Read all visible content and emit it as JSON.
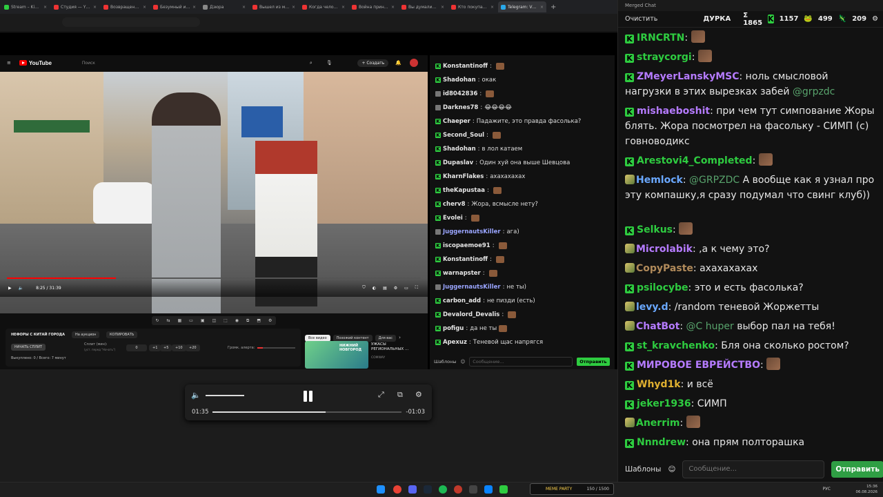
{
  "browser": {
    "tabs": [
      {
        "label": "Stream – Ki…",
        "color": "#2ecc40"
      },
      {
        "label": "Студия — Y…",
        "color": "#e33"
      },
      {
        "label": "Возвращен…",
        "color": "#e33"
      },
      {
        "label": "Безумный и…",
        "color": "#e33"
      },
      {
        "label": "Дзюра",
        "color": "#888"
      },
      {
        "label": "Вышел из м…",
        "color": "#e33"
      },
      {
        "label": "Когда чело…",
        "color": "#e33"
      },
      {
        "label": "Война прин…",
        "color": "#e33"
      },
      {
        "label": "Вы думали…",
        "color": "#e33"
      },
      {
        "label": "Кто покупа…",
        "color": "#e33"
      },
      {
        "label": "Telegram: V…",
        "color": "#29a9eb"
      }
    ]
  },
  "youtube": {
    "logo": "YouTube",
    "search_placeholder": "Поиск",
    "create": "+ Создать",
    "time": "8:25 / 31:39",
    "panel": {
      "title": "НЕФОРЫ С КИТАЙ ГОРОДА",
      "chip1": "На аукцион",
      "chip2": "КОПИРОВАТЬ",
      "start": "НАЧАТЬ СПЛИТ",
      "split_label": "Сплит (мин):",
      "split_sub": "(уст. перед \"Начать\")",
      "split_value": "0",
      "b1": "+1",
      "b2": "+5",
      "b3": "+10",
      "b4": "+20",
      "volume": "Громк. алерта:",
      "done": "Выкуплено: 0 / Всего: 7 минут"
    },
    "rel": {
      "chip_all": "Все видео",
      "chip_similar": "Похожий контент",
      "chip_you": "Для вас",
      "thumb_text": "НИЖНИЙ НОВГОРОД",
      "title": "УЖАСЫ РЕГИОНАЛЬНЫХ …",
      "channel": "COMWAY"
    }
  },
  "small_chat": {
    "messages": [
      {
        "name": "Konstantinoff",
        "color": "#e6e6e6",
        "text": "",
        "emote": true
      },
      {
        "name": "Shadohan",
        "color": "#e6e6e6",
        "text": "окак"
      },
      {
        "name": "id8042836",
        "color": "#e6e6e6",
        "text": "",
        "emote": true,
        "nok": true
      },
      {
        "name": "Darknes78",
        "color": "#e6e6e6",
        "text": "😂😂😂😂",
        "nok": true
      },
      {
        "name": "Chaeper",
        "color": "#e6e6e6",
        "text": "Падажите, это правда фасолька?"
      },
      {
        "name": "Second_Soul",
        "color": "#e6e6e6",
        "text": "",
        "emote": true
      },
      {
        "name": "Shadohan",
        "color": "#e6e6e6",
        "text": "в лол катаем"
      },
      {
        "name": "Dupaslav",
        "color": "#e6e6e6",
        "text": "Один хуй она выше Шевцова"
      },
      {
        "name": "KharnFlakes",
        "color": "#e6e6e6",
        "text": "ахахахахах"
      },
      {
        "name": "theKapustaa",
        "color": "#e6e6e6",
        "text": "",
        "emote": true
      },
      {
        "name": "cherv8",
        "color": "#e6e6e6",
        "text": "Жора, всмысле нету?"
      },
      {
        "name": "Evolei",
        "color": "#e6e6e6",
        "text": "",
        "emote": true
      },
      {
        "name": "JuggernautsKiller",
        "color": "#9aa5ff",
        "text": "ага)",
        "nok": true
      },
      {
        "name": "iscopaemoe91",
        "color": "#e6e6e6",
        "text": "",
        "emote": true
      },
      {
        "name": "Konstantinoff",
        "color": "#e6e6e6",
        "text": "",
        "emote": true
      },
      {
        "name": "warnapster",
        "color": "#e6e6e6",
        "text": "",
        "emote": true
      },
      {
        "name": "JuggernautsKiller",
        "color": "#9aa5ff",
        "text": "не ты)",
        "nok": true
      },
      {
        "name": "carbon_add",
        "color": "#e6e6e6",
        "text": "не пизди (есть)"
      },
      {
        "name": "Devalord_Devalis",
        "color": "#e6e6e6",
        "text": "",
        "emote": true
      },
      {
        "name": "pofigu",
        "color": "#e6e6e6",
        "text": "да не ты",
        "emote": true
      },
      {
        "name": "Apexuz",
        "color": "#e6e6e6",
        "text": "Теневой щас напрягся"
      }
    ],
    "templates": "Шаблоны",
    "placeholder": "Сообщение...",
    "send": "Отправить"
  },
  "media": {
    "elapsed": "01:35",
    "remaining": "-01:03",
    "progress": 0.6,
    "volume": 0.85
  },
  "taskbar": {
    "lang": "РУС",
    "time": "15:36",
    "date": "06.08.2026",
    "badge": "MEME PARTY",
    "badge_count": "150 / 1500"
  },
  "merged": {
    "window_title": "Merged Chat",
    "clear": "Очистить",
    "channel": "ДУРКА",
    "sum": "Σ 1865",
    "k_count": "1157",
    "c2": "499",
    "c3": "209",
    "messages": [
      {
        "badge": "k",
        "name": "IRNCRTN",
        "color": "#2ecc40",
        "text": "",
        "emote": true
      },
      {
        "badge": "k",
        "name": "straycorgi",
        "color": "#2ecc40",
        "text": "",
        "emote": true
      },
      {
        "badge": "k",
        "name": "ZMeyerLanskyMSC",
        "color": "#b57bff",
        "text": "ноль смысловой нагрузки в этих вырезках забей ",
        "mention": "@grpzdc"
      },
      {
        "badge": "k",
        "name": "mishaeboshit",
        "color": "#b57bff",
        "text": "при чем тут симпование Жоры блять. Жора посмотрел на фасольку - СИМП (с) говноводикс"
      },
      {
        "badge": "k",
        "name": "Arestovi4_Completed",
        "color": "#2ecc40",
        "text": "",
        "emote": true
      },
      {
        "badge": "tw",
        "name": "Hemlock",
        "color": "#6aa8ff",
        "mention": "@GRPZDC",
        "text": "А вообще как я узнал про эту  компашку,я сразу подумал что свинг клуб))"
      },
      {
        "badge": "k",
        "name": "Selkus",
        "color": "#2ecc40",
        "text": "",
        "emote": true
      },
      {
        "badge": "tw",
        "name": "Microlabik",
        "color": "#b57bff",
        "text": ",а к чему это?"
      },
      {
        "badge": "tw",
        "name": "CopyPaste",
        "color": "#b08a5a",
        "text": "ахахахахах"
      },
      {
        "badge": "k",
        "name": "psilocybe",
        "color": "#2ecc40",
        "text": "это и есть фасолька?"
      },
      {
        "badge": "tw",
        "name": "levy.d",
        "color": "#6aa8ff",
        "text": "/random теневой Жоржетты"
      },
      {
        "badge": "tw",
        "name": "ChatBot",
        "color": "#b57bff",
        "mention": "@C huper",
        "text": "выбор пал на тебя!"
      },
      {
        "badge": "k",
        "name": "st_kravchenko",
        "color": "#2ecc40",
        "text": "Бля она сколько ростом?"
      },
      {
        "badge": "k",
        "name": "МИРОВОЕ ЕВРЕЙСТВО",
        "color": "#b57bff",
        "text": "",
        "emote": true
      },
      {
        "badge": "k",
        "name": "Whyd1k",
        "color": "#e0b030",
        "text": "и всё"
      },
      {
        "badge": "k",
        "name": "jeker1936",
        "color": "#2ecc40",
        "text": "СИМП"
      },
      {
        "badge": "tw",
        "name": "Anerrim",
        "color": "#2ecc40",
        "text": "",
        "emote": true
      },
      {
        "badge": "k",
        "name": "Nnndrew",
        "color": "#2ecc40",
        "text": "она прям полторашка"
      }
    ],
    "templates": "Шаблоны",
    "placeholder": "Сообщение...",
    "send": "Отправить"
  }
}
